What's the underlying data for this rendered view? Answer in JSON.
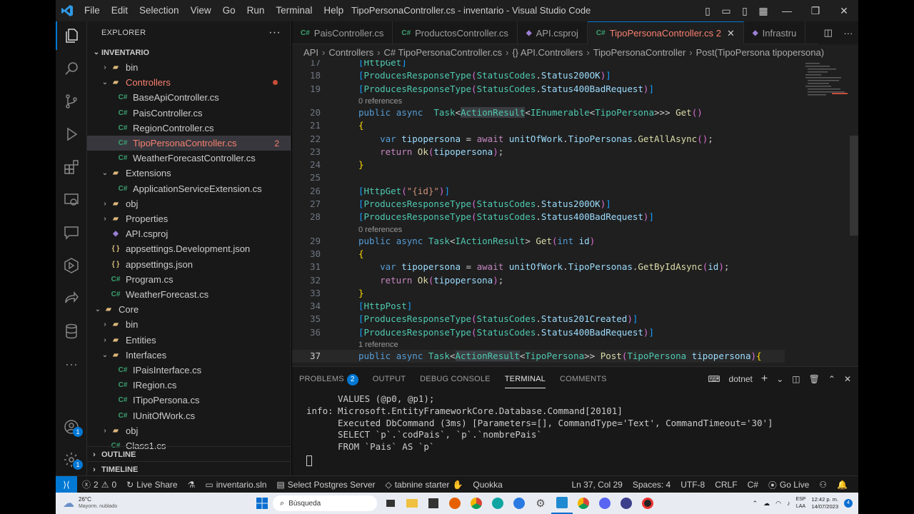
{
  "window": {
    "title": "TipoPersonaController.cs - inventario - Visual Studio Code",
    "menu": [
      "File",
      "Edit",
      "Selection",
      "View",
      "Go",
      "Run",
      "Terminal",
      "Help"
    ]
  },
  "activity": {
    "account_badge": "1",
    "settings_badge": "1"
  },
  "sidebar": {
    "header": "EXPLORER",
    "root": "INVENTARIO",
    "rows": [
      {
        "label": "bin",
        "type": "folder",
        "indent": 1,
        "twisty": "closed"
      },
      {
        "label": "Controllers",
        "type": "folder",
        "indent": 1,
        "twisty": "open",
        "git": "modified"
      },
      {
        "label": "BaseApiController.cs",
        "type": "cs",
        "indent": 2
      },
      {
        "label": "PaisController.cs",
        "type": "cs",
        "indent": 2
      },
      {
        "label": "RegionController.cs",
        "type": "cs",
        "indent": 2
      },
      {
        "label": "TipoPersonaController.cs",
        "type": "cs",
        "indent": 2,
        "selected": true,
        "badge": "2"
      },
      {
        "label": "WeatherForecastController.cs",
        "type": "cs",
        "indent": 2
      },
      {
        "label": "Extensions",
        "type": "folder",
        "indent": 1,
        "twisty": "open"
      },
      {
        "label": "ApplicationServiceExtension.cs",
        "type": "cs",
        "indent": 2
      },
      {
        "label": "obj",
        "type": "folder",
        "indent": 1,
        "twisty": "closed"
      },
      {
        "label": "Properties",
        "type": "folder",
        "indent": 1,
        "twisty": "closed"
      },
      {
        "label": "API.csproj",
        "type": "proj",
        "indent": 1
      },
      {
        "label": "appsettings.Development.json",
        "type": "json",
        "indent": 1
      },
      {
        "label": "appsettings.json",
        "type": "json",
        "indent": 1
      },
      {
        "label": "Program.cs",
        "type": "cs",
        "indent": 1
      },
      {
        "label": "WeatherForecast.cs",
        "type": "cs",
        "indent": 1
      },
      {
        "label": "Core",
        "type": "folder",
        "indent": 0,
        "twisty": "open"
      },
      {
        "label": "bin",
        "type": "folder",
        "indent": 1,
        "twisty": "closed"
      },
      {
        "label": "Entities",
        "type": "folder",
        "indent": 1,
        "twisty": "closed"
      },
      {
        "label": "Interfaces",
        "type": "folder",
        "indent": 1,
        "twisty": "open"
      },
      {
        "label": "IPaisInterface.cs",
        "type": "cs",
        "indent": 2
      },
      {
        "label": "IRegion.cs",
        "type": "cs",
        "indent": 2
      },
      {
        "label": "ITipoPersona.cs",
        "type": "cs",
        "indent": 2
      },
      {
        "label": "IUnitOfWork.cs",
        "type": "cs",
        "indent": 2
      },
      {
        "label": "obj",
        "type": "folder",
        "indent": 1,
        "twisty": "closed"
      },
      {
        "label": "Class1.cs",
        "type": "cs",
        "indent": 1
      }
    ],
    "outline": "OUTLINE",
    "timeline": "TIMELINE"
  },
  "tabs": [
    {
      "label": "PaisController.cs",
      "icon": "C#"
    },
    {
      "label": "ProductosController.cs",
      "icon": "C#"
    },
    {
      "label": "API.csproj",
      "icon": "proj"
    },
    {
      "label": "TipoPersonaController.cs 2",
      "icon": "C#",
      "active": true
    },
    {
      "label": "Infrastru",
      "icon": "proj"
    }
  ],
  "breadcrumb": [
    "API",
    "Controllers",
    "C# TipoPersonaController.cs",
    "{} API.Controllers",
    "TipoPersonaController",
    "Post(TipoPersona tipopersona)"
  ],
  "code": [
    {
      "n": "17",
      "t": [
        [
          "br3",
          "["
        ],
        [
          "ty",
          "HttpGet"
        ],
        [
          "br3",
          "]"
        ]
      ]
    },
    {
      "n": "18",
      "t": [
        [
          "br3",
          "["
        ],
        [
          "ty",
          "ProducesResponseType"
        ],
        [
          "br2",
          "("
        ],
        [
          "ty",
          "StatusCodes"
        ],
        [
          "",
          "."
        ],
        [
          "va",
          "Status200OK"
        ],
        [
          "br2",
          ")"
        ],
        [
          "br3",
          "]"
        ]
      ]
    },
    {
      "n": "19",
      "t": [
        [
          "br3",
          "["
        ],
        [
          "ty",
          "ProducesResponseType"
        ],
        [
          "br2",
          "("
        ],
        [
          "ty",
          "StatusCodes"
        ],
        [
          "",
          "."
        ],
        [
          "va",
          "Status400BadRequest"
        ],
        [
          "br2",
          ")"
        ],
        [
          "br3",
          "]"
        ]
      ]
    },
    {
      "ref": "0 references"
    },
    {
      "n": "20",
      "t": [
        [
          "kw",
          "public"
        ],
        [
          "",
          " "
        ],
        [
          "kw",
          "async"
        ],
        [
          "",
          "  "
        ],
        [
          "ty",
          "Task"
        ],
        [
          "",
          "<"
        ],
        [
          "ty hl",
          "ActionResult"
        ],
        [
          "",
          "<"
        ],
        [
          "ty",
          "IEnumerable"
        ],
        [
          "",
          "<"
        ],
        [
          "ty",
          "TipoPersona"
        ],
        [
          "",
          ">>> "
        ],
        [
          "fn",
          "Get"
        ],
        [
          "br2",
          "()"
        ]
      ]
    },
    {
      "n": "21",
      "t": [
        [
          "br1",
          "{"
        ]
      ]
    },
    {
      "n": "22",
      "t": [
        [
          "",
          "    "
        ],
        [
          "kw",
          "var"
        ],
        [
          "",
          " "
        ],
        [
          "va",
          "tipopersona"
        ],
        [
          "",
          " = "
        ],
        [
          "ct",
          "await"
        ],
        [
          "",
          " "
        ],
        [
          "va",
          "unitOfWork"
        ],
        [
          "",
          "."
        ],
        [
          "va",
          "TipoPersonas"
        ],
        [
          "",
          "."
        ],
        [
          "fn",
          "GetAllAsync"
        ],
        [
          "br2",
          "()"
        ],
        [
          "",
          ";"
        ]
      ]
    },
    {
      "n": "23",
      "t": [
        [
          "",
          "    "
        ],
        [
          "ct",
          "return"
        ],
        [
          "",
          " "
        ],
        [
          "fn",
          "Ok"
        ],
        [
          "br2",
          "("
        ],
        [
          "va",
          "tipopersona"
        ],
        [
          "br2",
          ")"
        ],
        [
          "",
          ";"
        ]
      ]
    },
    {
      "n": "24",
      "t": [
        [
          "br1",
          "}"
        ]
      ]
    },
    {
      "n": "25",
      "t": []
    },
    {
      "n": "26",
      "t": [
        [
          "br3",
          "["
        ],
        [
          "ty",
          "HttpGet"
        ],
        [
          "br2",
          "("
        ],
        [
          "st",
          "\"{id}\""
        ],
        [
          "br2",
          ")"
        ],
        [
          "br3",
          "]"
        ]
      ]
    },
    {
      "n": "27",
      "t": [
        [
          "br3",
          "["
        ],
        [
          "ty",
          "ProducesResponseType"
        ],
        [
          "br2",
          "("
        ],
        [
          "ty",
          "StatusCodes"
        ],
        [
          "",
          "."
        ],
        [
          "va",
          "Status200OK"
        ],
        [
          "br2",
          ")"
        ],
        [
          "br3",
          "]"
        ]
      ]
    },
    {
      "n": "28",
      "t": [
        [
          "br3",
          "["
        ],
        [
          "ty",
          "ProducesResponseType"
        ],
        [
          "br2",
          "("
        ],
        [
          "ty",
          "StatusCodes"
        ],
        [
          "",
          "."
        ],
        [
          "va",
          "Status400BadRequest"
        ],
        [
          "br2",
          ")"
        ],
        [
          "br3",
          "]"
        ]
      ]
    },
    {
      "ref": "0 references"
    },
    {
      "n": "29",
      "t": [
        [
          "kw",
          "public"
        ],
        [
          "",
          " "
        ],
        [
          "kw",
          "async"
        ],
        [
          "",
          " "
        ],
        [
          "ty",
          "Task"
        ],
        [
          "",
          "<"
        ],
        [
          "ty",
          "IActionResult"
        ],
        [
          "",
          "> "
        ],
        [
          "fn",
          "Get"
        ],
        [
          "br2",
          "("
        ],
        [
          "kw",
          "int"
        ],
        [
          "",
          " "
        ],
        [
          "va",
          "id"
        ],
        [
          "br2",
          ")"
        ]
      ]
    },
    {
      "n": "30",
      "t": [
        [
          "br1",
          "{"
        ]
      ]
    },
    {
      "n": "31",
      "t": [
        [
          "",
          "    "
        ],
        [
          "kw",
          "var"
        ],
        [
          "",
          " "
        ],
        [
          "va",
          "tipopersona"
        ],
        [
          "",
          " = "
        ],
        [
          "ct",
          "await"
        ],
        [
          "",
          " "
        ],
        [
          "va",
          "unitOfWork"
        ],
        [
          "",
          "."
        ],
        [
          "va",
          "TipoPersonas"
        ],
        [
          "",
          "."
        ],
        [
          "fn",
          "GetByIdAsync"
        ],
        [
          "br2",
          "("
        ],
        [
          "va",
          "id"
        ],
        [
          "br2",
          ")"
        ],
        [
          "",
          ";"
        ]
      ]
    },
    {
      "n": "32",
      "t": [
        [
          "",
          "    "
        ],
        [
          "ct",
          "return"
        ],
        [
          "",
          " "
        ],
        [
          "fn",
          "Ok"
        ],
        [
          "br2",
          "("
        ],
        [
          "va",
          "tipopersona"
        ],
        [
          "br2",
          ")"
        ],
        [
          "",
          ";"
        ]
      ]
    },
    {
      "n": "33",
      "t": [
        [
          "br1",
          "}"
        ]
      ]
    },
    {
      "n": "34",
      "t": [
        [
          "br3",
          "["
        ],
        [
          "ty",
          "HttpPost"
        ],
        [
          "br3",
          "]"
        ]
      ]
    },
    {
      "n": "35",
      "t": [
        [
          "br3",
          "["
        ],
        [
          "ty",
          "ProducesResponseType"
        ],
        [
          "br2",
          "("
        ],
        [
          "ty",
          "StatusCodes"
        ],
        [
          "",
          "."
        ],
        [
          "va",
          "Status201Created"
        ],
        [
          "br2",
          ")"
        ],
        [
          "br3",
          "]"
        ]
      ]
    },
    {
      "n": "36",
      "t": [
        [
          "br3",
          "["
        ],
        [
          "ty",
          "ProducesResponseType"
        ],
        [
          "br2",
          "("
        ],
        [
          "ty",
          "StatusCodes"
        ],
        [
          "",
          "."
        ],
        [
          "va",
          "Status400BadRequest"
        ],
        [
          "br2",
          ")"
        ],
        [
          "br3",
          "]"
        ]
      ]
    },
    {
      "ref": "1 reference"
    },
    {
      "n": "37",
      "cur": true,
      "t": [
        [
          "kw",
          "public"
        ],
        [
          "",
          " "
        ],
        [
          "kw",
          "async"
        ],
        [
          "",
          " "
        ],
        [
          "ty",
          "Task"
        ],
        [
          "",
          "<"
        ],
        [
          "ty hl",
          "ActionResult"
        ],
        [
          "",
          "<"
        ],
        [
          "ty",
          "TipoPersona"
        ],
        [
          "",
          ">> "
        ],
        [
          "fn",
          "Post"
        ],
        [
          "br2",
          "("
        ],
        [
          "ty",
          "TipoPersona"
        ],
        [
          "",
          " "
        ],
        [
          "va",
          "tipopersona"
        ],
        [
          "br2",
          ")"
        ],
        [
          "br1",
          "{"
        ]
      ]
    }
  ],
  "panel": {
    "tabs": [
      "PROBLEMS",
      "OUTPUT",
      "DEBUG CONSOLE",
      "TERMINAL",
      "COMMENTS"
    ],
    "problems_count": "2",
    "active": "TERMINAL",
    "shell": "dotnet",
    "terminal": [
      {
        "prefix": "",
        "text": "VALUES (@p0, @p1);"
      },
      {
        "prefix": "info:",
        "text": "Microsoft.EntityFrameworkCore.Database.Command[20101]"
      },
      {
        "prefix": "",
        "text": "Executed DbCommand (3ms) [Parameters=[], CommandType='Text', CommandTimeout='30']"
      },
      {
        "prefix": "",
        "text": "SELECT `p`.`codPais`, `p`.`nombrePais`"
      },
      {
        "prefix": "",
        "text": "FROM `Pais` AS `p`"
      }
    ]
  },
  "status": {
    "errors": "2",
    "warnings": "0",
    "live_share": "Live Share",
    "solution": "inventario.sln",
    "postgres": "Select Postgres Server",
    "tabnine": "tabnine starter",
    "quokka": "Quokka",
    "position": "Ln 37, Col 29",
    "spaces": "Spaces: 4",
    "encoding": "UTF-8",
    "eol": "CRLF",
    "language": "C#",
    "golive": "Go Live"
  },
  "taskbar": {
    "weather_temp": "26°C",
    "weather_desc": "Mayorm. nublado",
    "search_placeholder": "Búsqueda",
    "lang1": "ESP",
    "lang2": "LAA",
    "time": "12:42 p. m.",
    "date": "14/07/2023",
    "notif": "4"
  }
}
